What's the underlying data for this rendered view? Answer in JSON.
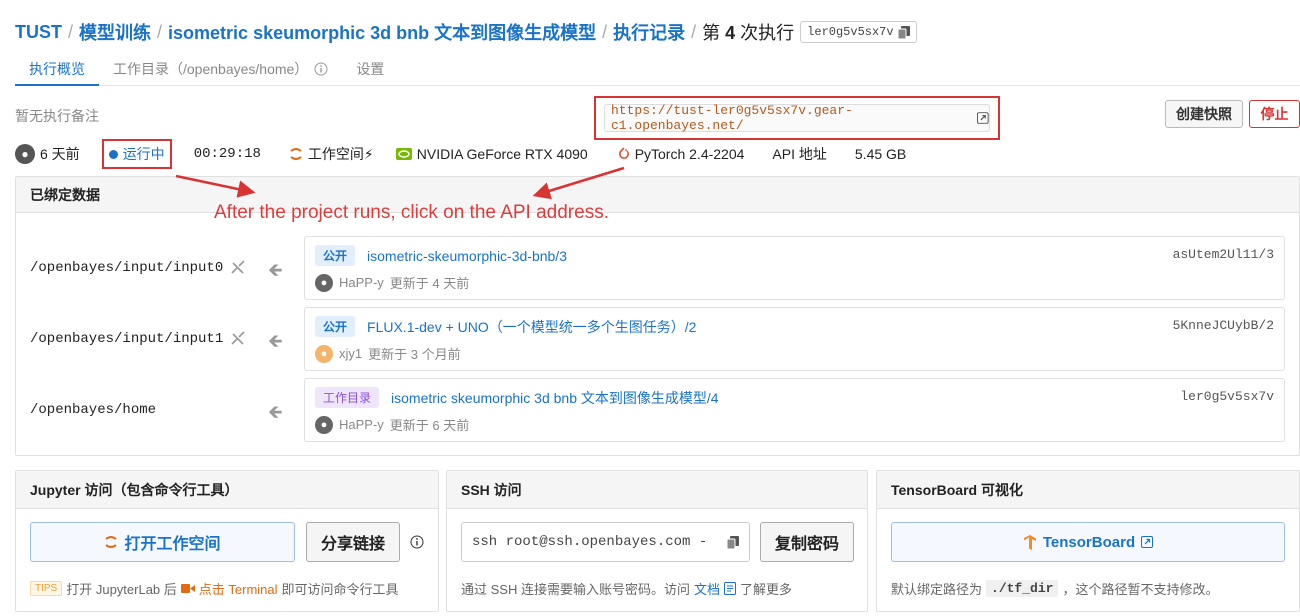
{
  "breadcrumb": {
    "root": "TUST",
    "model_training": "模型训练",
    "project": "isometric skeumorphic 3d bnb 文本到图像生成模型",
    "runs": "执行记录",
    "current_prefix": "第",
    "current_num": "4",
    "current_suffix": "次执行",
    "run_id": "ler0g5v5sx7v"
  },
  "tabs": [
    {
      "label": "执行概览"
    },
    {
      "label": "工作目录（/openbayes/home）"
    },
    {
      "label": "设置"
    }
  ],
  "note": "暂无执行备注",
  "api_url": "https://tust-ler0g5v5sx7v.gear-c1.openbayes.net/",
  "buttons": {
    "snapshot": "创建快照",
    "stop": "停止"
  },
  "status": {
    "created": "6 天前",
    "state": "运行中",
    "elapsed": "00:29:18",
    "workspace": "工作空间⚡",
    "gpu": "NVIDIA GeForce RTX 4090",
    "framework": "PyTorch 2.4-2204",
    "api": "API 地址",
    "size": "5.45 GB"
  },
  "annotation": "After the project runs, click on the API address.",
  "bound": {
    "title": "已绑定数据",
    "rows": [
      {
        "path": "/openbayes/input/input0",
        "badge": "公开",
        "title": "isometric-skeumorphic-3d-bnb/3",
        "hash": "asUtem2Ul11/3",
        "user": "HaPP-y",
        "updated": "更新于 4 天前"
      },
      {
        "path": "/openbayes/input/input1",
        "badge": "公开",
        "title": "FLUX.1-dev + UNO（一个模型统一多个生图任务）/2",
        "hash": "5KnneJCUybB/2",
        "user": "xjy1",
        "updated": "更新于 3 个月前"
      },
      {
        "path": "/openbayes/home",
        "badge": "工作目录",
        "title": "isometric skeumorphic 3d bnb 文本到图像生成模型/4",
        "hash": "ler0g5v5sx7v",
        "user": "HaPP-y",
        "updated": "更新于 6 天前"
      }
    ]
  },
  "jupyter": {
    "title": "Jupyter 访问（包含命令行工具）",
    "open": "打开工作空间",
    "share": "分享链接",
    "tips": "TIPS",
    "f1": "打开 JupyterLab 后",
    "f2": "点击 Terminal",
    "f3": "即可访问命令行工具"
  },
  "ssh": {
    "title": "SSH 访问",
    "cmd": "ssh root@ssh.openbayes.com -",
    "copy": "复制密码",
    "f1": "通过 SSH 连接需要输入账号密码。访问",
    "f2": "文档",
    "f3": "了解更多"
  },
  "tensorboard": {
    "title": "TensorBoard 可视化",
    "btn": "TensorBoard",
    "f1": "默认绑定路径为",
    "f2": "./tf_dir",
    "f3": "，这个路径暂不支持修改。"
  }
}
